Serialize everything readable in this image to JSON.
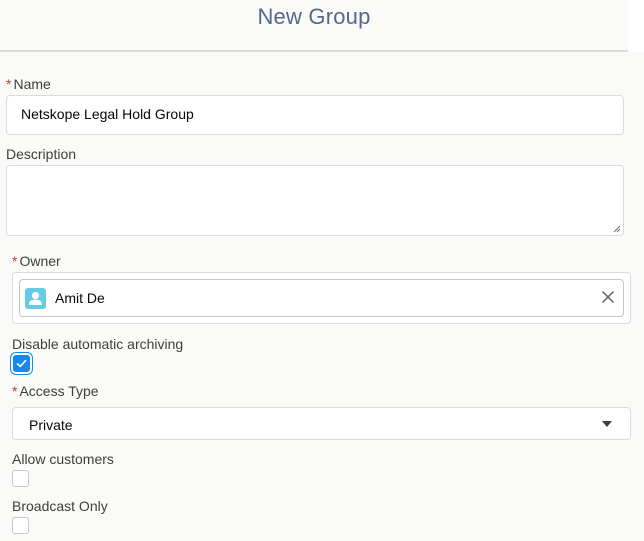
{
  "header": {
    "title": "New Group"
  },
  "form": {
    "required_marker": "*",
    "name": {
      "label": "Name",
      "value": "Netskope Legal Hold Group"
    },
    "description": {
      "label": "Description",
      "value": ""
    },
    "owner": {
      "label": "Owner",
      "value": "Amit De",
      "avatar_icon": "user-icon",
      "clear_icon": "close-icon"
    },
    "disable_archiving": {
      "label": "Disable automatic archiving",
      "checked": true
    },
    "access_type": {
      "label": "Access Type",
      "selected": "Private"
    },
    "allow_customers": {
      "label": "Allow customers",
      "checked": false
    },
    "broadcast_only": {
      "label": "Broadcast Only",
      "checked": false
    }
  },
  "colors": {
    "required": "#c23934",
    "accent": "#1589ee",
    "avatar": "#65cae4",
    "title": "#54698d"
  }
}
